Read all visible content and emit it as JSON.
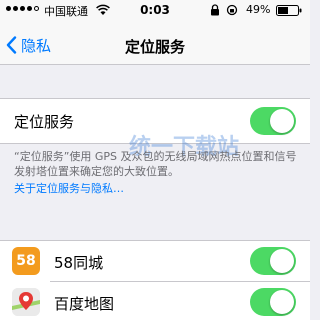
{
  "status_bar": {
    "carrier": "中国联通",
    "time": "0:03",
    "battery_percent": "49%"
  },
  "nav": {
    "back_label": "隐私",
    "title": "定位服务"
  },
  "location_services": {
    "label": "定位服务",
    "enabled": true,
    "description": "“定位服务”使用 GPS 及众包的无线局域网热点位置和信号发射塔位置来确定您的大致位置。",
    "link_label": "关于定位服务与隐私…"
  },
  "apps": [
    {
      "name": "58同城",
      "icon_text": "58",
      "enabled": true
    },
    {
      "name": "百度地图",
      "enabled": true
    }
  ],
  "watermark_text": "统一下载站",
  "colors": {
    "accent": "#007aff",
    "toggle_on": "#4cd964",
    "background": "#efeff4"
  }
}
